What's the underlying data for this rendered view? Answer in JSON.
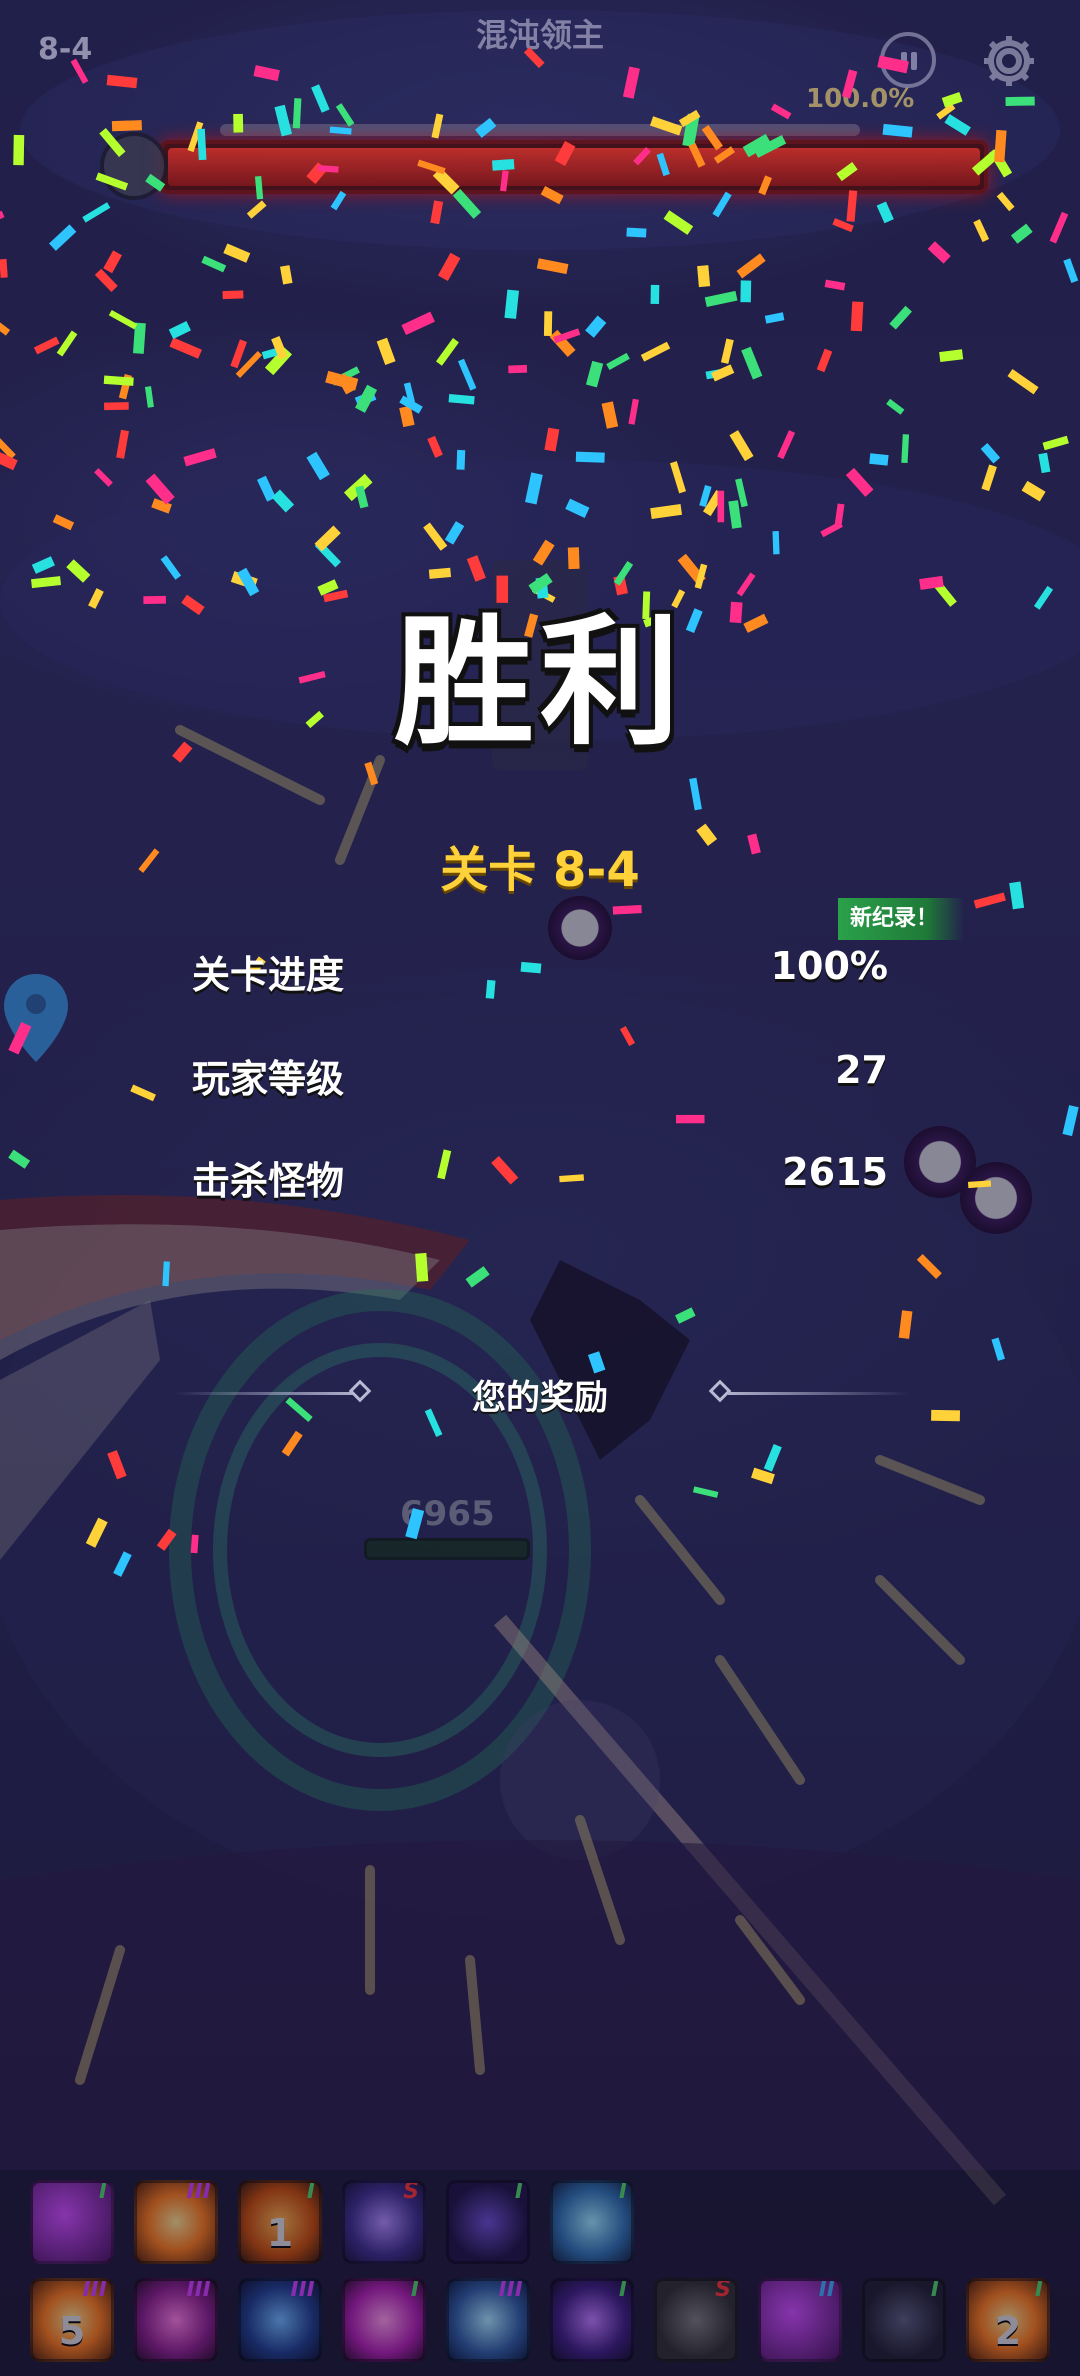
{
  "hud": {
    "level": "8-4",
    "boss_title": "混沌领主",
    "boss_progress_text": "100.0%",
    "boss_progress_fraction": 1.0
  },
  "result": {
    "victory_text": "胜利",
    "stage_label": "关卡 8-4",
    "new_record_badge": "新纪录！",
    "stats": [
      {
        "label": "关卡进度",
        "value": "100%"
      },
      {
        "label": "玩家等级",
        "value": "27"
      },
      {
        "label": "击杀怪物",
        "value": "2615"
      }
    ],
    "rewards_title": "您的奖励"
  },
  "world": {
    "enemy_hp_text": "6965"
  },
  "skills": {
    "row1": [
      {
        "icon": "purple-slash-skill-icon",
        "tier": "I",
        "level": ""
      },
      {
        "icon": "fire-burst-skill-icon",
        "tier": "III",
        "level": ""
      },
      {
        "icon": "flame-skill-icon",
        "tier": "I",
        "level": "1"
      },
      {
        "icon": "lightning-skill-icon",
        "tier": "S",
        "level": ""
      },
      {
        "icon": "dark-vortex-skill-icon",
        "tier": "I",
        "level": ""
      },
      {
        "icon": "ice-ring-skill-icon",
        "tier": "I",
        "level": ""
      }
    ],
    "row2": [
      {
        "icon": "fire-burst-skill-icon",
        "tier": "III",
        "level": "5"
      },
      {
        "icon": "hexagon-shield-skill-icon",
        "tier": "III",
        "level": ""
      },
      {
        "icon": "arc-skill-icon",
        "tier": "III",
        "level": ""
      },
      {
        "icon": "pink-explosion-skill-icon",
        "tier": "I",
        "level": ""
      },
      {
        "icon": "magnet-skill-icon",
        "tier": "III",
        "level": ""
      },
      {
        "icon": "purple-orb-skill-icon",
        "tier": "I",
        "level": ""
      },
      {
        "icon": "gear-skill-icon",
        "tier": "S",
        "level": ""
      },
      {
        "icon": "purple-slash-skill-icon",
        "tier": "II",
        "level": ""
      },
      {
        "icon": "dark-blade-skill-icon",
        "tier": "I",
        "level": ""
      },
      {
        "icon": "fire-burst-skill-icon",
        "tier": "I",
        "level": "2"
      }
    ]
  },
  "colors": {
    "victory_gold": "#ffd23a",
    "new_record_green": "#2aa14a",
    "boss_bar_red": "#e03020"
  }
}
